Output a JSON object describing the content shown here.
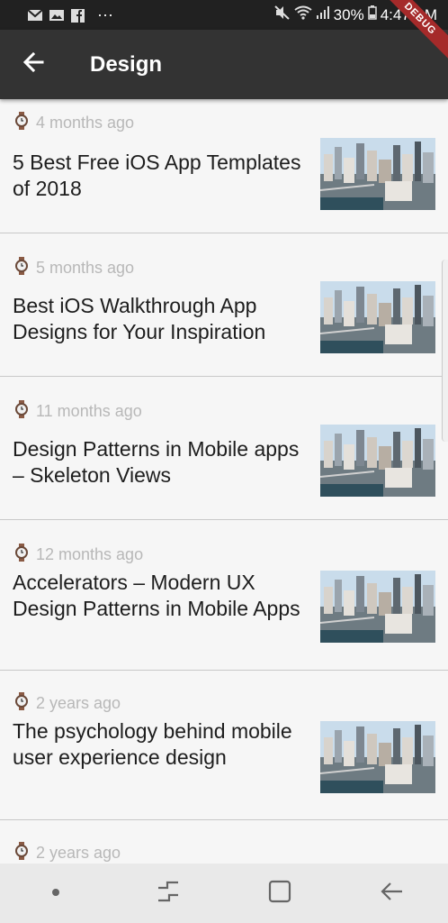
{
  "status_bar": {
    "battery": "30%",
    "time": "4:47 PM",
    "more": "···",
    "icons": [
      "gmail-icon",
      "gallery-icon",
      "facebook-icon",
      "mute-icon",
      "wifi-icon",
      "signal-icon",
      "battery-icon"
    ]
  },
  "app_bar": {
    "title": "Design",
    "back_icon": "arrow-left-icon"
  },
  "debug_banner": "DEBUG",
  "articles": [
    {
      "time": "4 months ago",
      "title": "5 Best Free iOS App Templates of 2018"
    },
    {
      "time": "5 months ago",
      "title": "Best iOS Walkthrough App Designs for Your Inspiration"
    },
    {
      "time": "11 months ago",
      "title": "Design Patterns in Mobile apps – Skeleton Views"
    },
    {
      "time": "12 months ago",
      "title": "Accelerators – Modern UX Design Patterns in Mobile Apps"
    },
    {
      "time": "2 years ago",
      "title": "The psychology behind mobile user experience design"
    },
    {
      "time": "2 years ago",
      "title": ""
    }
  ],
  "nav_bar": {
    "icons": [
      "dot-icon",
      "recents-icon",
      "home-icon",
      "back-icon"
    ]
  },
  "colors": {
    "app_bar": "#333333",
    "status_bar": "#212121",
    "meta_text": "#b8b8b8",
    "ribbon": "#a52a2a"
  }
}
